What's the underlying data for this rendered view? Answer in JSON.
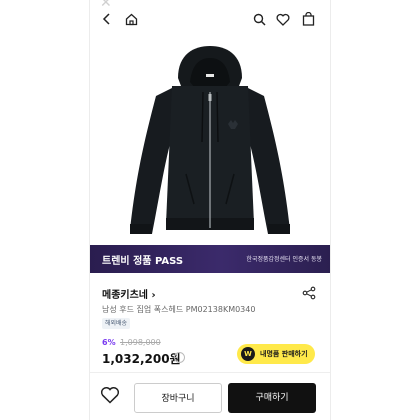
{
  "topbar": {
    "back_icon": "chevron-left-icon",
    "home_icon": "home-icon",
    "search_icon": "search-icon",
    "wishlist_icon": "heart-icon",
    "bag_icon": "shopping-bag-icon"
  },
  "banner": {
    "title_prefix": "트렌비 정품",
    "title_suffix": "PASS",
    "subtitle": "한국정품감정센터 인증서 동봉"
  },
  "product": {
    "brand": "메종키츠네",
    "name": "남성 후드 집업 폭스헤드 PM02138KM0340",
    "badge": "해외배송",
    "discount": "6%",
    "original_price": "1,098,000",
    "price": "1,032,200원",
    "info_icon": "info-icon"
  },
  "sell_button": {
    "label": "내명품 판매하기",
    "icon_text": "W"
  },
  "actions": {
    "heart_icon": "heart-icon",
    "cart_label": "장바구니",
    "buy_label": "구매하기"
  },
  "colors": {
    "banner_bg": "#2f225a",
    "discount": "#7a3cf0",
    "sell_bg": "#ffe94a",
    "buy_bg": "#111111"
  }
}
